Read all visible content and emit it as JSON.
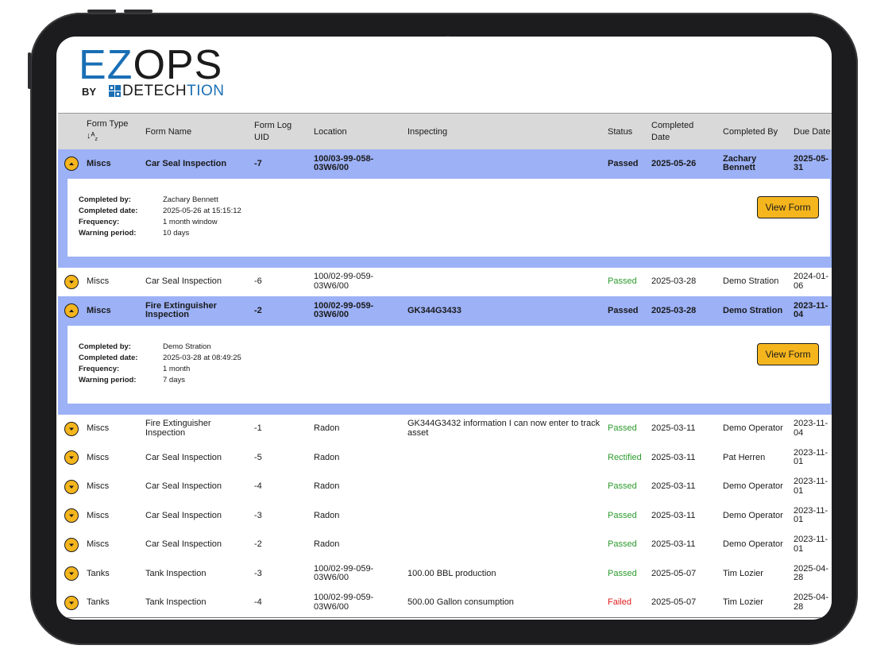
{
  "brand": {
    "name_part1": "EZ",
    "name_part2": "OPS",
    "by": "BY",
    "company_part1": "DETECH",
    "company_part2": "TION"
  },
  "table": {
    "headers": {
      "form_type": "Form Type",
      "form_name": "Form Name",
      "form_log_uid_1": "Form Log",
      "form_log_uid_2": "UID",
      "location": "Location",
      "inspecting": "Inspecting",
      "status": "Status",
      "completed_date_1": "Completed",
      "completed_date_2": "Date",
      "completed_by": "Completed By",
      "due_date": "Due Date"
    },
    "detail_labels": {
      "completed_by": "Completed by:",
      "completed_date": "Completed date:",
      "frequency": "Frequency:",
      "warning_period": "Warning period:",
      "view_form": "View Form"
    },
    "rows": [
      {
        "form_type": "Miscs",
        "form_name": "Car Seal Inspection",
        "uid": "-7",
        "location": "100/03-99-058-03W6/00",
        "inspecting": "",
        "status": "Passed",
        "completed_date": "2025-05-26",
        "completed_by": "Zachary Bennett",
        "due_date": "2025-05-31",
        "expanded": true,
        "detail": {
          "completed_by": "Zachary Bennett",
          "completed_date": "2025-05-26 at 15:15:12",
          "frequency": "1 month window",
          "warning_period": "10 days"
        }
      },
      {
        "form_type": "Miscs",
        "form_name": "Car Seal Inspection",
        "uid": "-6",
        "location": "100/02-99-059-03W6/00",
        "inspecting": "",
        "status": "Passed",
        "completed_date": "2025-03-28",
        "completed_by": "Demo Stration",
        "due_date": "2024-01-06",
        "expanded": false
      },
      {
        "form_type": "Miscs",
        "form_name": "Fire Extinguisher Inspection",
        "uid": "-2",
        "location": "100/02-99-059-03W6/00",
        "inspecting": "GK344G3433",
        "status": "Passed",
        "completed_date": "2025-03-28",
        "completed_by": "Demo Stration",
        "due_date": "2023-11-04",
        "expanded": true,
        "detail": {
          "completed_by": "Demo Stration",
          "completed_date": "2025-03-28 at 08:49:25",
          "frequency": "1 month",
          "warning_period": "7 days"
        }
      },
      {
        "form_type": "Miscs",
        "form_name": "Fire Extinguisher Inspection",
        "uid": "-1",
        "location": "Radon",
        "inspecting": "GK344G3432 information I can now enter to track asset",
        "status": "Passed",
        "completed_date": "2025-03-11",
        "completed_by": "Demo Operator",
        "due_date": "2023-11-04",
        "expanded": false
      },
      {
        "form_type": "Miscs",
        "form_name": "Car Seal Inspection",
        "uid": "-5",
        "location": "Radon",
        "inspecting": "",
        "status": "Rectified",
        "completed_date": "2025-03-11",
        "completed_by": "Pat Herren",
        "due_date": "2023-11-01",
        "expanded": false
      },
      {
        "form_type": "Miscs",
        "form_name": "Car Seal Inspection",
        "uid": "-4",
        "location": "Radon",
        "inspecting": "",
        "status": "Passed",
        "completed_date": "2025-03-11",
        "completed_by": "Demo Operator",
        "due_date": "2023-11-01",
        "expanded": false
      },
      {
        "form_type": "Miscs",
        "form_name": "Car Seal Inspection",
        "uid": "-3",
        "location": "Radon",
        "inspecting": "",
        "status": "Passed",
        "completed_date": "2025-03-11",
        "completed_by": "Demo Operator",
        "due_date": "2023-11-01",
        "expanded": false
      },
      {
        "form_type": "Miscs",
        "form_name": "Car Seal Inspection",
        "uid": "-2",
        "location": "Radon",
        "inspecting": "",
        "status": "Passed",
        "completed_date": "2025-03-11",
        "completed_by": "Demo Operator",
        "due_date": "2023-11-01",
        "expanded": false
      },
      {
        "form_type": "Tanks",
        "form_name": "Tank Inspection",
        "uid": "-3",
        "location": "100/02-99-059-03W6/00",
        "inspecting": "100.00 BBL production",
        "status": "Passed",
        "completed_date": "2025-05-07",
        "completed_by": "Tim Lozier",
        "due_date": "2025-04-28",
        "expanded": false
      },
      {
        "form_type": "Tanks",
        "form_name": "Tank Inspection",
        "uid": "-4",
        "location": "100/02-99-059-03W6/00",
        "inspecting": "500.00 Gallon consumption",
        "status": "Failed",
        "completed_date": "2025-05-07",
        "completed_by": "Tim Lozier",
        "due_date": "2025-04-28",
        "expanded": false
      }
    ]
  },
  "colors": {
    "accent_blue": "#1a6fb5",
    "expanded_row": "#9cb1f6",
    "button_yellow": "#f5b51d",
    "status_passed": "#2c9b2c",
    "status_failed": "#e01b1b"
  }
}
